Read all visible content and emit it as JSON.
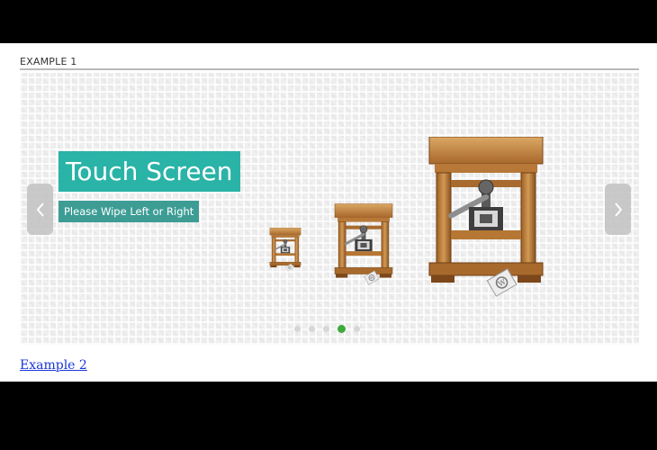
{
  "section": {
    "title": "EXAMPLE 1"
  },
  "slider": {
    "caption_title": "Touch Screen",
    "caption_subtitle": "Please Wipe Left or Right",
    "icons": [
      "wordpress-press-icon",
      "wordpress-press-icon",
      "wordpress-press-icon"
    ],
    "pagination": {
      "count": 5,
      "active_index": 3
    },
    "colors": {
      "caption_title_bg": "#2ab3a7",
      "caption_subtitle_bg": "#3d9d95",
      "active_dot": "#3eaa3c"
    },
    "prev_icon": "chevron-left-icon",
    "next_icon": "chevron-right-icon"
  },
  "links": {
    "example2": "Example 2"
  }
}
